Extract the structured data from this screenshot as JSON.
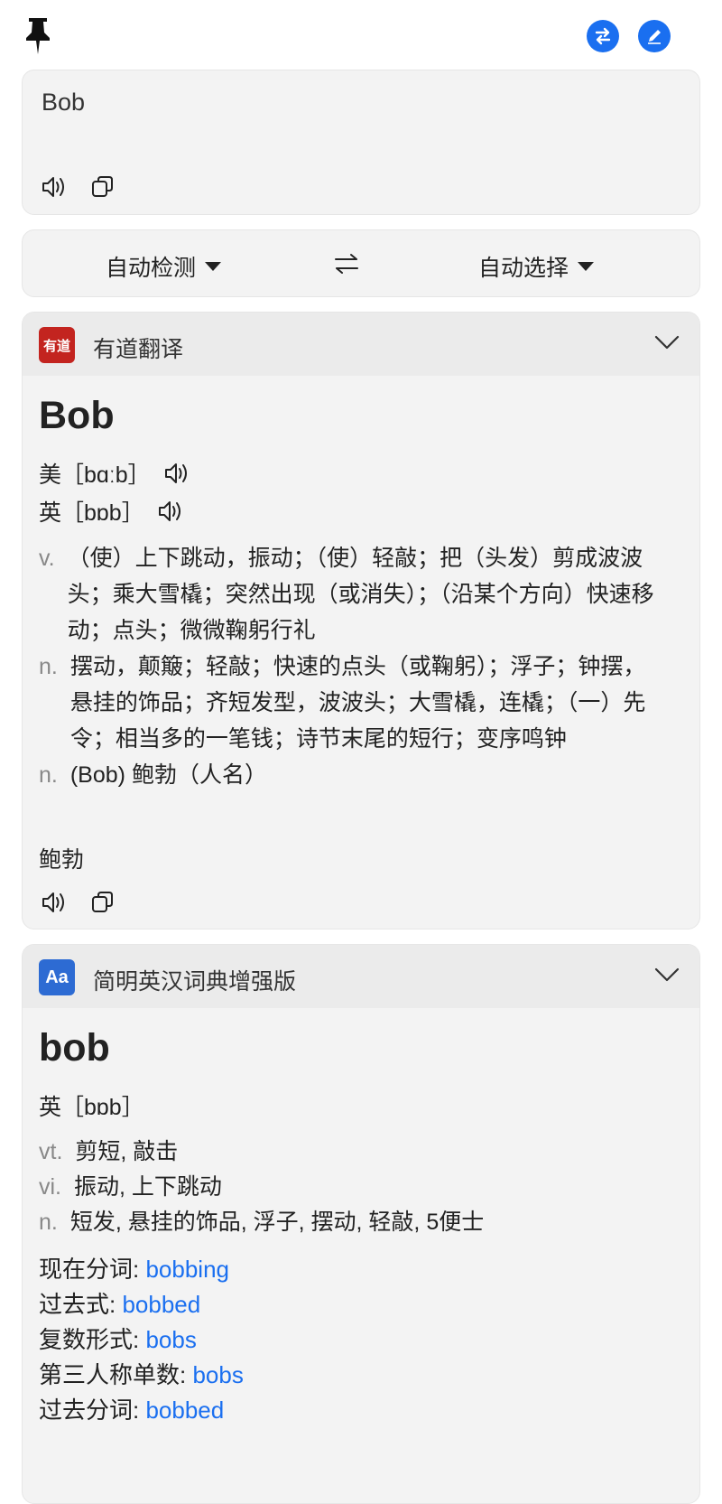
{
  "source_text": "Bob",
  "languages": {
    "from": "自动检测",
    "to": "自动选择"
  },
  "icons": {
    "pin": "pin-icon",
    "swap": "swap-icon",
    "edit": "edit-icon",
    "speaker": "speaker-icon",
    "copy": "copy-icon",
    "chevron": "chevron-down-icon"
  },
  "colors": {
    "accent": "#1a6ff0",
    "youdao_red": "#c3241f",
    "dict_blue": "#2d6bd3"
  },
  "youdao": {
    "logo_text": "有道",
    "title": "有道翻译",
    "word": "Bob",
    "us": "美［bɑːb］",
    "uk": "英［bɒb］",
    "defs": [
      {
        "pos": "v.",
        "text": "（使）上下跳动，振动；（使）轻敲；把（头发）剪成波波头；乘大雪橇；突然出现（或消失）；（沿某个方向）快速移动；点头；微微鞠躬行礼"
      },
      {
        "pos": "n.",
        "text": "摆动，颠簸；轻敲；快速的点头（或鞠躬）；浮子；钟摆，悬挂的饰品；齐短发型，波波头；大雪橇，连橇；（一）先令；相当多的一笔钱；诗节末尾的短行；变序鸣钟"
      },
      {
        "pos": "n.",
        "text": "(Bob) 鲍勃（人名）"
      }
    ],
    "translation": "鲍勃"
  },
  "dict": {
    "logo_text": "Aa",
    "title": "简明英汉词典增强版",
    "word": "bob",
    "uk": "英［bɒb］",
    "defs": [
      {
        "pos": "vt.",
        "text": "剪短, 敲击"
      },
      {
        "pos": "vi.",
        "text": "振动, 上下跳动"
      },
      {
        "pos": "n.",
        "text": "短发, 悬挂的饰品, 浮子, 摆动, 轻敲, 5便士"
      }
    ],
    "forms": [
      {
        "label": "现在分词:",
        "value": "bobbing"
      },
      {
        "label": "过去式:",
        "value": "bobbed"
      },
      {
        "label": "复数形式:",
        "value": "bobs"
      },
      {
        "label": "第三人称单数:",
        "value": "bobs"
      },
      {
        "label": "过去分词:",
        "value": "bobbed"
      }
    ]
  }
}
